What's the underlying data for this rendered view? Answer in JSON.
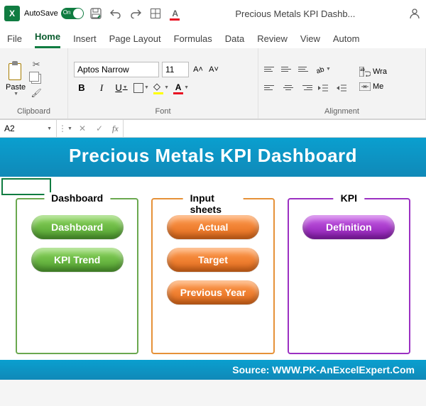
{
  "titlebar": {
    "autosave_label": "AutoSave",
    "autosave_on": "On",
    "doc_title": "Precious Metals KPI Dashb..."
  },
  "tabs": {
    "file": "File",
    "home": "Home",
    "insert": "Insert",
    "page_layout": "Page Layout",
    "formulas": "Formulas",
    "data": "Data",
    "review": "Review",
    "view": "View",
    "automate": "Autom"
  },
  "ribbon": {
    "clipboard": {
      "label": "Clipboard",
      "paste": "Paste"
    },
    "font": {
      "label": "Font",
      "name": "Aptos Narrow",
      "size": "11",
      "inc": "A˄",
      "dec": "A˅",
      "bold": "B",
      "italic": "I",
      "underline": "U"
    },
    "alignment": {
      "label": "Alignment",
      "wrap": "Wra",
      "merge": "Me"
    }
  },
  "namebox": "A2",
  "fx_label": "fx",
  "dashboard": {
    "banner": "Precious Metals KPI Dashboard",
    "cards": {
      "dashboard": {
        "title": "Dashboard",
        "btn1": "Dashboard",
        "btn2": "KPI Trend"
      },
      "input": {
        "title": "Input sheets",
        "btn1": "Actual",
        "btn2": "Target",
        "btn3": "Previous Year"
      },
      "kpi": {
        "title": "KPI",
        "btn1": "Definition"
      }
    },
    "source": "Source: WWW.PK-AnExcelExpert.Com"
  }
}
